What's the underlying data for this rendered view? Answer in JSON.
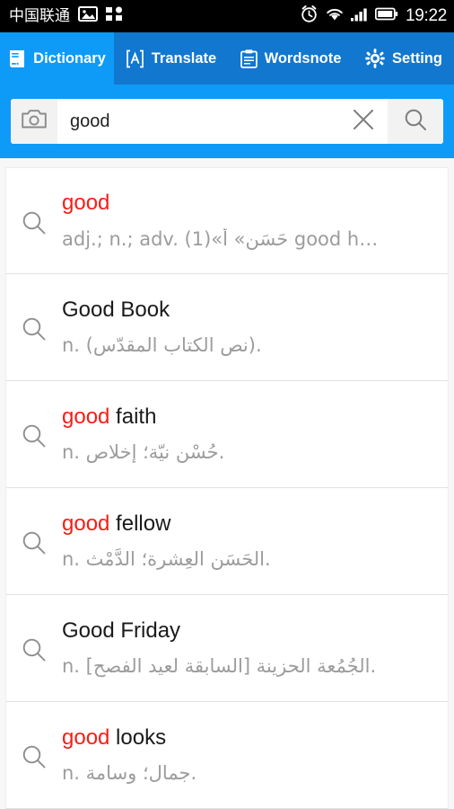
{
  "status_bar": {
    "carrier": "中国联通",
    "time": "19:22",
    "icons": [
      "image-icon",
      "apps-grid-icon",
      "alarm-clock-icon",
      "wifi-icon",
      "signal-bars-icon",
      "battery-icon"
    ]
  },
  "tabs": [
    {
      "label": "Dictionary",
      "icon": "book-icon",
      "active": true
    },
    {
      "label": "Translate",
      "icon": "translate-a-icon",
      "active": false
    },
    {
      "label": "Wordsnote",
      "icon": "clipboard-notes-icon",
      "active": false
    },
    {
      "label": "Setting",
      "icon": "gear-icon",
      "active": false
    }
  ],
  "search": {
    "value": "good",
    "placeholder": "",
    "camera_icon": "camera-icon",
    "clear_icon": "close-x-icon",
    "search_icon": "search-icon"
  },
  "results": [
    {
      "title_highlight": "good",
      "title_rest": "",
      "subtitle": "adj.; n.; adv. (1)«حَسَن» أ good h…",
      "row_icon": "search-icon"
    },
    {
      "title_highlight": "",
      "title_rest": "Good Book",
      "subtitle": "n. (نص الكتاب المقدّس).",
      "row_icon": "search-icon"
    },
    {
      "title_highlight": "good",
      "title_rest": " faith",
      "subtitle": "n. حُسْن نيّة؛ إِخلاص.",
      "row_icon": "search-icon"
    },
    {
      "title_highlight": "good",
      "title_rest": " fellow",
      "subtitle": "n. الحَسَن العِشرة؛ الدَّمْث.",
      "row_icon": "search-icon"
    },
    {
      "title_highlight": "",
      "title_rest": "Good Friday",
      "subtitle": "n. الجُمُعة الحزينة [السابقة لعيد الفصح].",
      "row_icon": "search-icon"
    },
    {
      "title_highlight": "good",
      "title_rest": " looks",
      "subtitle": "n. جمال؛ وسامة.",
      "row_icon": "search-icon"
    }
  ],
  "colors": {
    "status_bar_bg": "#000000",
    "tab_bar_bg": "#1277cf",
    "accent_blue": "#0d9bf7",
    "highlight_red": "#f81d16",
    "subtitle_grey": "#9c9c9c"
  }
}
